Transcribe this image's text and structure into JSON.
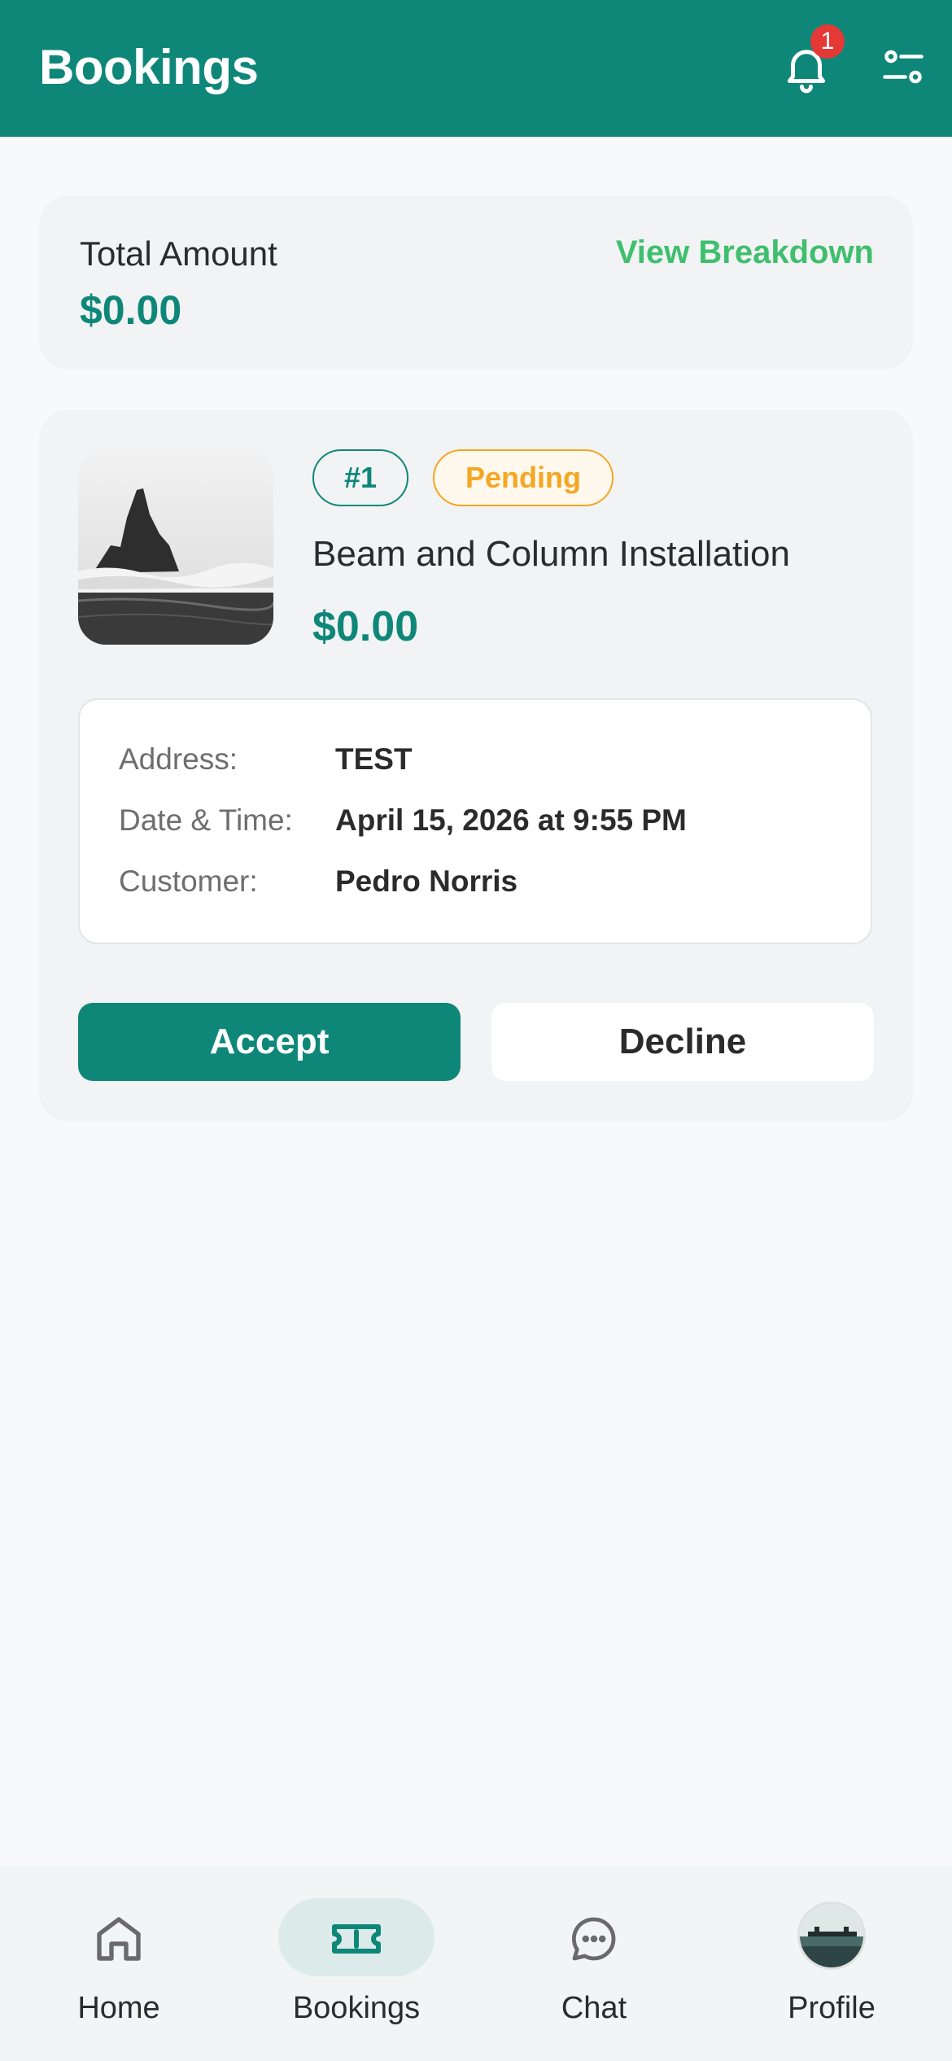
{
  "header": {
    "title": "Bookings",
    "notification_count": "1"
  },
  "summary": {
    "total_label": "Total Amount",
    "total_amount": "$0.00",
    "view_breakdown": "View Breakdown"
  },
  "booking": {
    "id_tag": "#1",
    "status": "Pending",
    "title": "Beam and Column Installation",
    "price": "$0.00",
    "details": {
      "address_label": "Address:",
      "address_value": "TEST",
      "datetime_label": "Date & Time:",
      "datetime_value": "April 15, 2026 at 9:55 PM",
      "customer_label": "Customer:",
      "customer_value": "Pedro Norris"
    },
    "accept_label": "Accept",
    "decline_label": "Decline"
  },
  "tabbar": {
    "items": [
      {
        "label": "Home",
        "icon": "home-icon"
      },
      {
        "label": "Bookings",
        "icon": "ticket-icon",
        "active": true
      },
      {
        "label": "Chat",
        "icon": "chat-icon"
      },
      {
        "label": "Profile",
        "icon": "avatar"
      }
    ]
  },
  "colors": {
    "brand": "#0e8779",
    "status_pending": "#f5a623",
    "link": "#3fbf6e",
    "badge": "#e53935"
  }
}
